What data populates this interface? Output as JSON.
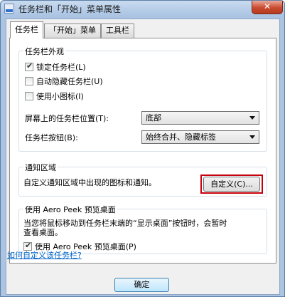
{
  "window": {
    "title": "任务栏和「开始」菜单属性",
    "close_glyph": "✕"
  },
  "tabs": [
    {
      "label": "任务栏",
      "active": true
    },
    {
      "label": "「开始」菜单",
      "active": false
    },
    {
      "label": "工具栏",
      "active": false
    }
  ],
  "appearance": {
    "title": "任务栏外观",
    "checkboxes": [
      {
        "label": "锁定任务栏(L)",
        "checked": true
      },
      {
        "label": "自动隐藏任务栏(U)",
        "checked": false
      },
      {
        "label": "使用小图标(I)",
        "checked": false
      }
    ],
    "location_label": "屏幕上的任务栏位置(T):",
    "location_value": "底部",
    "buttons_label": "任务栏按钮(B):",
    "buttons_value": "始终合并、隐藏标签"
  },
  "notification": {
    "title": "通知区域",
    "description": "自定义通知区域中出现的图标和通知。",
    "customize_label": "自定义(C)..."
  },
  "aero_peek": {
    "title": "使用 Aero Peek 预览桌面",
    "description_line1": "当您将鼠标移动到任务栏末端的“显示桌面”按钮时，会暂时",
    "description_line2": "查看桌面。",
    "checkbox_label": "使用 Aero Peek 预览桌面(P)",
    "checked": true
  },
  "help_link": "如何自定义该任务栏?",
  "ok_label": "确定",
  "icons": {
    "title_icon": "taskbar-properties-icon",
    "dropdown_icon": "chevron-down-icon"
  }
}
